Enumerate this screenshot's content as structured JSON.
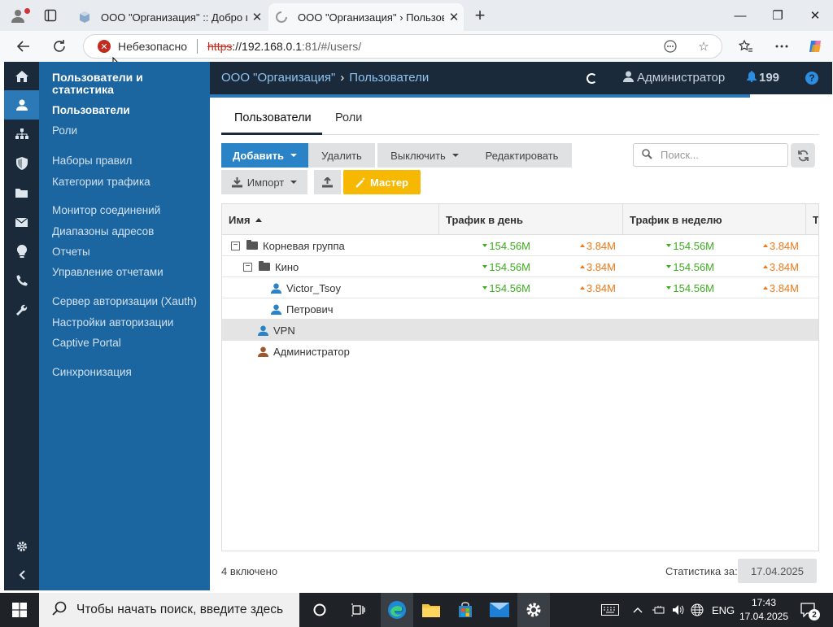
{
  "browser": {
    "tabs": [
      {
        "title": "ООО \"Организация\" :: Добро по",
        "close": "✕"
      },
      {
        "title": "ООО \"Организация\" › Пользоват",
        "close": "✕"
      }
    ],
    "new_tab": "+",
    "address": {
      "security_label": "Небезопасно",
      "scheme": "https",
      "host": "://192.168.0.1",
      "rest": ":81/#/users/"
    },
    "window": {
      "minimize": "—",
      "maximize": "❐",
      "close": "✕"
    }
  },
  "app": {
    "sidebar": {
      "section_title": "Пользователи и статистика",
      "items": [
        {
          "label": "Пользователи",
          "active": true
        },
        {
          "label": "Роли"
        },
        {
          "label": "Наборы правил"
        },
        {
          "label": "Категории трафика"
        },
        {
          "label": "Монитор соединений"
        },
        {
          "label": "Диапазоны адресов"
        },
        {
          "label": "Отчеты"
        },
        {
          "label": "Управление отчетами"
        },
        {
          "label": "Сервер авторизации (Xauth)"
        },
        {
          "label": "Настройки авторизации"
        },
        {
          "label": "Captive Portal"
        },
        {
          "label": "Синхронизация"
        }
      ]
    },
    "topbar": {
      "breadcrumb_org": "ООО \"Организация\"",
      "breadcrumb_sep": "›",
      "breadcrumb_page": "Пользователи",
      "user": "Администратор",
      "notifications": "199",
      "help": "?"
    },
    "tabs": [
      {
        "label": "Пользователи"
      },
      {
        "label": "Роли"
      }
    ],
    "toolbar": {
      "add": "Добавить",
      "delete": "Удалить",
      "disable": "Выключить",
      "edit": "Редактировать",
      "import": "Импорт",
      "wizard": "Мастер",
      "search_placeholder": "Поиск..."
    },
    "grid": {
      "columns": [
        "Имя",
        "Трафик в день",
        "Трафик в неделю",
        "Т"
      ],
      "rows": [
        {
          "name": "Корневая группа",
          "day_down": "154.56M",
          "day_up": "3.84M",
          "week_down": "154.56M",
          "week_up": "3.84M"
        },
        {
          "name": "Кино",
          "day_down": "154.56M",
          "day_up": "3.84M",
          "week_down": "154.56M",
          "week_up": "3.84M"
        },
        {
          "name": "Victor_Tsoy",
          "day_down": "154.56M",
          "day_up": "3.84M",
          "week_down": "154.56M",
          "week_up": "3.84M"
        },
        {
          "name": "Петрович"
        },
        {
          "name": "VPN"
        },
        {
          "name": "Администратор"
        }
      ]
    },
    "footer": {
      "count": "4 включено",
      "stat_label": "Статистика за:",
      "date": "17.04.2025"
    }
  },
  "taskbar": {
    "search_placeholder": "Чтобы начать поиск, введите здесь",
    "lang": "ENG",
    "time": "17:43",
    "date": "17.04.2025",
    "notif_count": "2"
  }
}
